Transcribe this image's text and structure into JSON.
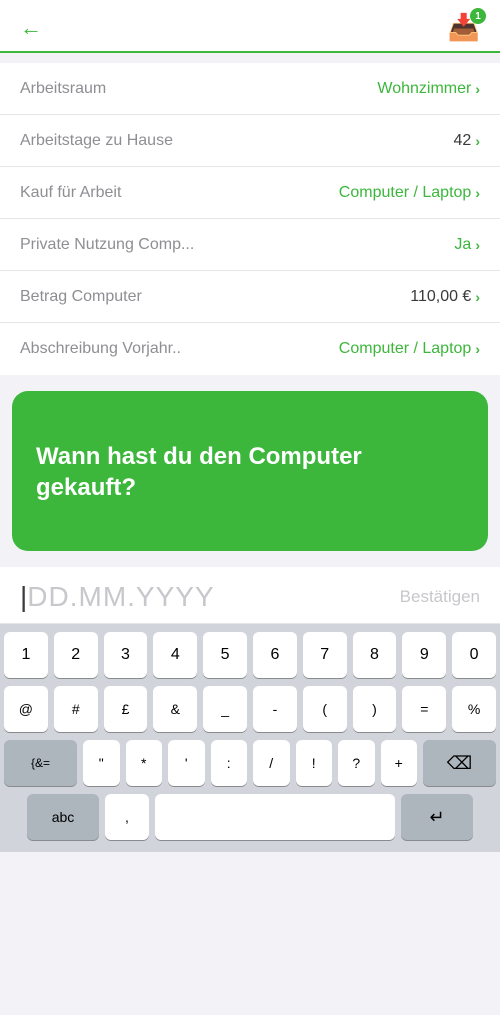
{
  "header": {
    "back_label": "←",
    "badge_count": "1"
  },
  "form_rows": [
    {
      "label": "Arbeitsraum",
      "value": "Wohnzimmer",
      "value_color": "green"
    },
    {
      "label": "Arbeitstage zu Hause",
      "value": "42",
      "value_color": "black"
    },
    {
      "label": "Kauf für Arbeit",
      "value": "Computer / Laptop",
      "value_color": "green"
    },
    {
      "label": "Private Nutzung Comp...",
      "value": "Ja",
      "value_color": "green"
    },
    {
      "label": "Betrag Computer",
      "value": "110,00 €",
      "value_color": "black"
    },
    {
      "label": "Abschreibung Vorjahr..",
      "value": "Computer / Laptop",
      "value_color": "green"
    }
  ],
  "green_card": {
    "text": "Wann hast du den Computer gekauft?"
  },
  "date_input": {
    "placeholder": "DD.MM.YYYY",
    "confirm_label": "Bestätigen"
  },
  "keyboard": {
    "rows": [
      [
        "1",
        "2",
        "3",
        "4",
        "5",
        "6",
        "7",
        "8",
        "9",
        "0"
      ],
      [
        "@",
        "#",
        "£",
        "&",
        "_",
        "-",
        "(",
        ")",
        "=",
        "%"
      ],
      [
        "{&=",
        "\"",
        "*",
        "'",
        ":",
        "/",
        "!",
        "?",
        "+",
        "⌫"
      ],
      [
        "abc",
        ",",
        "space",
        "↵"
      ]
    ]
  }
}
